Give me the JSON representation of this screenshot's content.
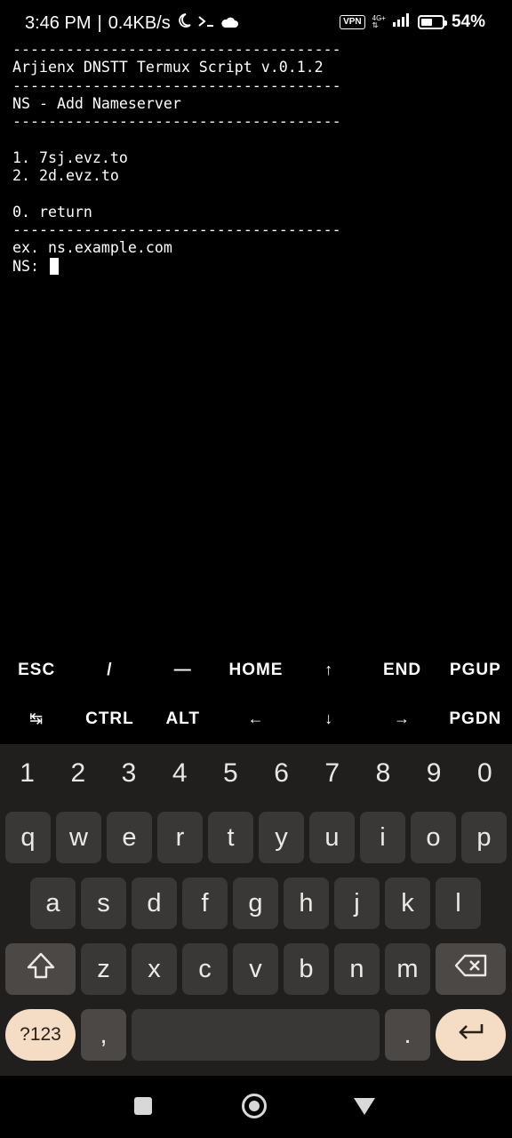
{
  "status_bar": {
    "time": "3:46 PM",
    "speed": "0.4KB/s",
    "icons": [
      "moon-icon",
      "terminal-icon",
      "cloud-icon",
      "vpn-icon",
      "signal-icon",
      "battery-icon"
    ],
    "vpn": "VPN",
    "network_type": "4G+",
    "battery_percent": "54%",
    "battery_level": 0.54
  },
  "terminal": {
    "lines": [
      "-------------------------------------",
      "Arjienx DNSTT Termux Script v.0.1.2",
      "-------------------------------------",
      "NS - Add Nameserver",
      "-------------------------------------",
      "",
      "1. 7sj.evz.to",
      "2. 2d.evz.to",
      "",
      "0. return",
      "-------------------------------------",
      "ex. ns.example.com"
    ],
    "prompt": "NS: "
  },
  "extra_keys": {
    "row1": [
      "ESC",
      "/",
      "—",
      "HOME",
      "↑",
      "END",
      "PGUP"
    ],
    "row2": [
      "↹",
      "CTRL",
      "ALT",
      "←",
      "↓",
      "→",
      "PGDN"
    ]
  },
  "keyboard": {
    "numbers": [
      "1",
      "2",
      "3",
      "4",
      "5",
      "6",
      "7",
      "8",
      "9",
      "0"
    ],
    "row1": [
      "q",
      "w",
      "e",
      "r",
      "t",
      "y",
      "u",
      "i",
      "o",
      "p"
    ],
    "row2": [
      "a",
      "s",
      "d",
      "f",
      "g",
      "h",
      "j",
      "k",
      "l"
    ],
    "row3": [
      "z",
      "x",
      "c",
      "v",
      "b",
      "n",
      "m"
    ],
    "symbols_label": "?123",
    "comma": ",",
    "period": ".",
    "shift_icon": "shift-icon",
    "backspace_icon": "backspace-icon",
    "enter_icon": "enter-icon"
  },
  "colors": {
    "keyboard_bg": "#201f1e",
    "key_bg": "#3a3836",
    "accent_key": "#f5dcc5"
  }
}
